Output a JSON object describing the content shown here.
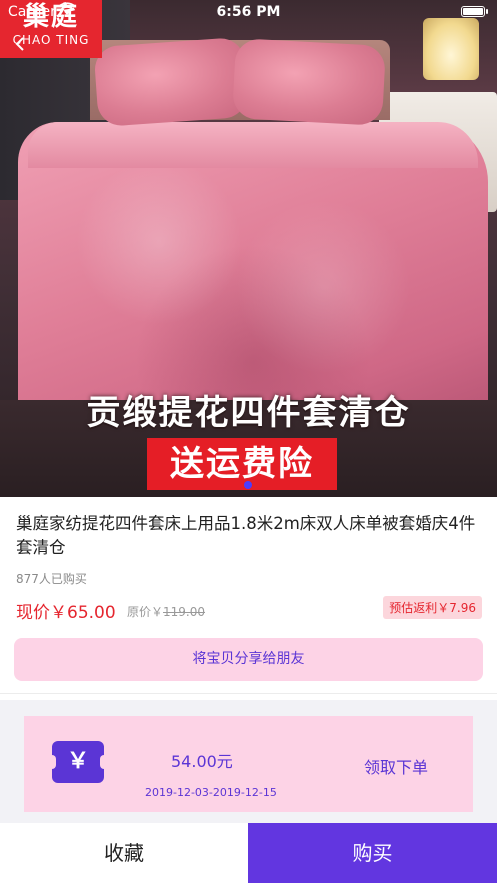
{
  "status_bar": {
    "carrier": "Carrier",
    "time": "6:56 PM"
  },
  "hero": {
    "brand_cn": "巢庭",
    "brand_en": "CHAO TING",
    "banner_line": "贡缎提花四件套清仓",
    "banner_box": "送运费险"
  },
  "product": {
    "title": "巢庭家纺提花四件套床上用品1.8米2m床双人床单被套婚庆4件套清仓",
    "sold": "877人已购买",
    "price_now": "现价￥65.00",
    "price_orig_label": "原价￥",
    "price_orig_value": "119.00",
    "rebate": "预估返利￥7.96"
  },
  "share_label": "将宝贝分享给朋友",
  "coupon": {
    "icon": "yen-icon",
    "symbol": "￥",
    "amount": "54.00元",
    "date_range": "2019-12-03-2019-12-15",
    "claim_label": "领取下单"
  },
  "bottom_bar": {
    "favorite_label": "收藏",
    "buy_label": "购买"
  },
  "colors": {
    "accent": "#6236e0",
    "price_red": "#e5262f",
    "pink_bg": "#fdd3e6"
  }
}
